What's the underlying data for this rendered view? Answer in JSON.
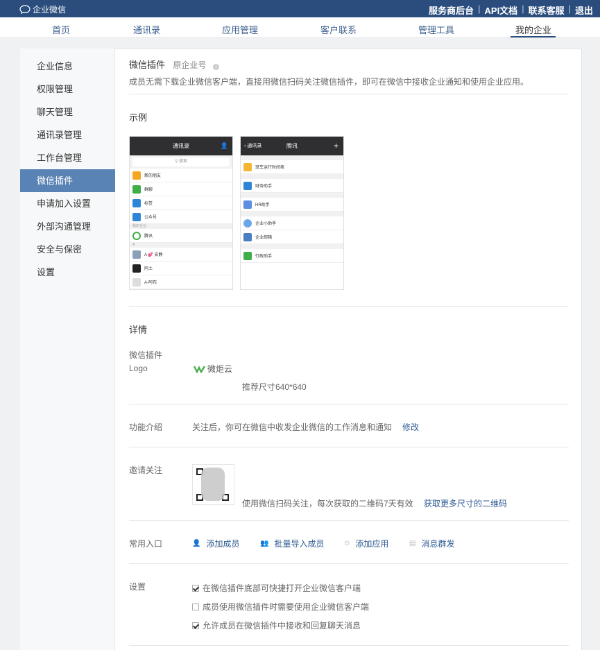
{
  "topbar": {
    "brand": "企业微信",
    "links": [
      "服务商后台",
      "API文档",
      "联系客服",
      "退出"
    ]
  },
  "nav": {
    "items": [
      "首页",
      "通讯录",
      "应用管理",
      "客户联系",
      "管理工具",
      "我的企业"
    ],
    "active": "我的企业"
  },
  "sidebar": {
    "items": [
      "企业信息",
      "权限管理",
      "聊天管理",
      "通讯录管理",
      "工作台管理",
      "微信插件",
      "申请加入设置",
      "外部沟通管理",
      "安全与保密",
      "设置"
    ],
    "active": "微信插件"
  },
  "header": {
    "title": "微信插件",
    "subtitle": "原企业号",
    "description": "成员无需下载企业微信客户端，直接用微信扫码关注微信插件，即可在微信中接收企业通知和使用企业应用。"
  },
  "example": {
    "title": "示例",
    "phone1": {
      "header": "通讯录",
      "search": "搜索",
      "rows": [
        "新的朋友",
        "群聊",
        "标签",
        "公众号"
      ],
      "group1": "我的企业",
      "company": "腾讯",
      "group2": "A",
      "contacts": [
        "A 💕 安静",
        "阿土",
        "A-阿布"
      ]
    },
    "phone2": {
      "back": "通讯录",
      "header": "腾讯",
      "rows": [
        "班车运行时间表",
        "财务助手",
        "HR助手",
        "企业小助手",
        "企业邮箱",
        "行政助手"
      ]
    }
  },
  "details": {
    "title": "详情",
    "logo_label": "微信插件 Logo",
    "logo_text": "微炬云",
    "logo_hint": "推荐尺寸640*640",
    "intro_label": "功能介绍",
    "intro_text": "关注后，你可在微信中收发企业微信的工作消息和通知",
    "intro_edit": "修改",
    "invite_label": "邀请关注",
    "invite_text": "使用微信扫码关注，每次获取的二维码7天有效",
    "invite_link": "获取更多尺寸的二维码",
    "entry_label": "常用入口",
    "entries": [
      "添加成员",
      "批量导入成员",
      "添加应用",
      "消息群发"
    ],
    "settings_label": "设置",
    "settings": [
      {
        "text": "在微信插件底部可快捷打开企业微信客户端",
        "checked": true
      },
      {
        "text": "成员使用微信插件时需要使用企业微信客户端",
        "checked": false
      },
      {
        "text": "允许成员在微信插件中接收和回复聊天消息",
        "checked": true
      }
    ]
  },
  "colors": {
    "topbar": "#2a4d7d",
    "active_sidebar": "#5a83b5",
    "link": "#2d5a92"
  }
}
